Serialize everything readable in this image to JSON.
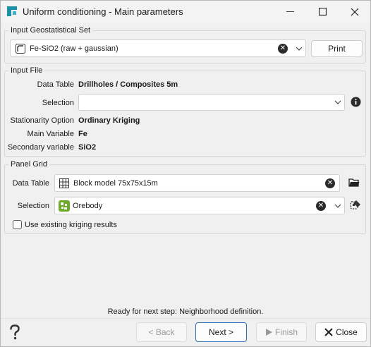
{
  "window": {
    "title": "Uniform conditioning - Main parameters"
  },
  "input_geostat_set": {
    "group_title": "Input Geostatistical Set",
    "value": "Fe-SiO2 (raw + gaussian)",
    "print_label": "Print"
  },
  "input_file": {
    "group_title": "Input File",
    "data_table_label": "Data Table",
    "data_table_value": "Drillholes / Composites 5m",
    "selection_label": "Selection",
    "selection_value": "",
    "stationarity_label": "Stationarity Option",
    "stationarity_value": "Ordinary Kriging",
    "main_variable_label": "Main Variable",
    "main_variable_value": "Fe",
    "secondary_variable_label": "Secondary variable",
    "secondary_variable_value": "SiO2"
  },
  "panel_grid": {
    "group_title": "Panel Grid",
    "data_table_label": "Data Table",
    "data_table_value": "Block model 75x75x15m",
    "selection_label": "Selection",
    "selection_value": "Orebody",
    "use_existing_label": "Use existing kriging results",
    "use_existing_checked": false
  },
  "status": {
    "text": "Ready for next step: Neighborhood definition."
  },
  "footer": {
    "back_label": "< Back",
    "next_label": "Next >",
    "finish_label": "Finish",
    "close_label": "Close"
  },
  "colors": {
    "accent": "#2a6fb8",
    "app_icon": "#1a8fa8",
    "selection_icon": "#6cab2a",
    "info_icon": "#2b2b2b"
  }
}
